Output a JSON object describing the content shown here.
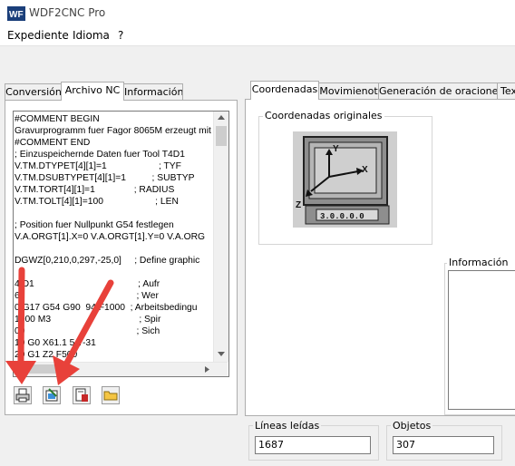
{
  "window": {
    "title": "WDF2CNC Pro",
    "app_icon_text": "WF"
  },
  "menu": [
    "Expediente",
    "Idioma",
    "?"
  ],
  "left_tabs": [
    "Conversión",
    "Archivo NC",
    "Información"
  ],
  "nc_lines": [
    "#COMMENT BEGIN",
    "Gravurprogramm fuer Fagor 8065M erzeugt mit",
    "#COMMENT END",
    "; Einzuspeichernde Daten fuer Tool T4D1",
    "V.TM.DTYPET[4][1]=1                    ; TYF",
    "V.TM.DSUBTYPET[4][1]=1          ; SUBTYP",
    "V.TM.TORT[4][1]=1               ; RADIUS",
    "V.TM.TOLT[4][1]=100                    ; LEN",
    "",
    "; Position fuer Nullpunkt G54 festlegen",
    "V.A.ORGT[1].X=0 V.A.ORGT[1].Y=0 V.A.ORG",
    "",
    "DGWZ[0,210,0,297,-25,0]     ; Define graphic",
    "",
    "4 D1                                        ; Aufr",
    "6                                             ; Wer",
    "0 G17 G54 G90  94 F1000  ; Arbeitsbedingu",
    "1000 M3                                  ; Spir",
    "00                                           ; Sich",
    "10 G0 X61.1 5 Y-31",
    "20 G1 Z2 F500"
  ],
  "right_tabs": [
    "Coordenadas",
    "Movimienot",
    "Generación de oraciones",
    "Tex"
  ],
  "coords_group_label": "Coordenadas originales",
  "axis_labels": {
    "y": "Y",
    "x": "X",
    "z": "Z"
  },
  "monitor_digits": "3.0.0.0.0",
  "info_group_label": "Información de",
  "lineas_label": "Líneas leídas",
  "lineas_value": "1687",
  "objetos_label": "Objetos",
  "objetos_value": "307",
  "colors": {
    "arrow": "#e8413a",
    "tab_border": "#adadad",
    "selection": "#0078d7"
  }
}
